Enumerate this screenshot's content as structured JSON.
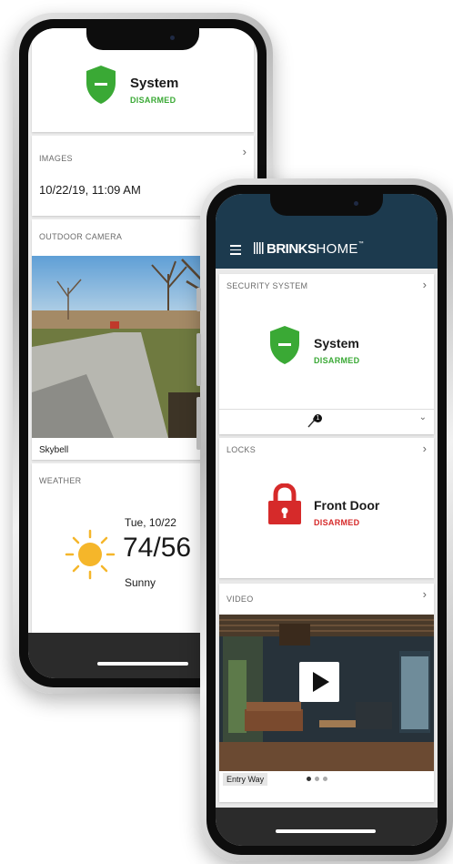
{
  "back_phone": {
    "system_title": "System",
    "system_status": "DISARMED",
    "images_label": "IMAGES",
    "images_timestamp": "10/22/19, 11:09 AM",
    "outdoor_label": "OUTDOOR CAMERA",
    "camera_name": "Skybell",
    "weather_label": "WEATHER",
    "weather_date": "Tue, 10/22",
    "weather_temp": "74/56",
    "weather_condition": "Sunny"
  },
  "front_phone": {
    "brand_bold": "BRINKS",
    "brand_light": "HOME",
    "brand_tm": "™",
    "security_label": "SECURITY SYSTEM",
    "system_title": "System",
    "system_status": "DISARMED",
    "sensor_badge": "1",
    "locks_label": "LOCKS",
    "lock_title": "Front Door",
    "lock_status": "DISARMED",
    "video_label": "VIDEO",
    "video_camera": "Entry Way"
  },
  "colors": {
    "header_bg": "#1c3a4e",
    "armed_green": "#3aa935",
    "lock_red": "#d62a2a",
    "sun_yellow": "#f5b62a"
  },
  "icons": [
    "menu-icon",
    "shield-icon",
    "lock-icon",
    "camera-icon",
    "sun-icon",
    "play-icon",
    "chevron-right-icon",
    "chevron-down-icon",
    "sensor-icon"
  ]
}
